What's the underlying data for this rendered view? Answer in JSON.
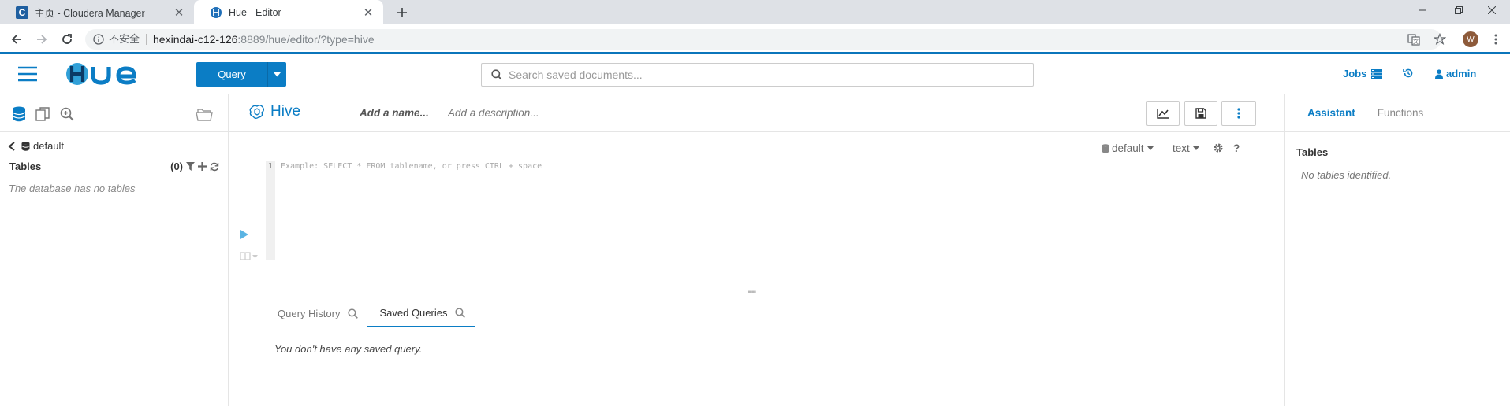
{
  "browser": {
    "tabs": [
      {
        "title": "主页 - Cloudera Manager",
        "favicon_letter": "C",
        "active": false
      },
      {
        "title": "Hue - Editor",
        "active": true
      }
    ],
    "new_tab_icon": "plus-icon",
    "security_label": "不安全",
    "url_host": "hexindai-c12-126",
    "url_path": ":8889/hue/editor/?type=hive",
    "avatar_letter": "W"
  },
  "nav": {
    "query_button": "Query",
    "search_placeholder": "Search saved documents...",
    "jobs_label": "Jobs",
    "user_label": "admin"
  },
  "left_panel": {
    "database": "default",
    "tables_label": "Tables",
    "tables_count": "(0)",
    "empty_message": "The database has no tables"
  },
  "editor": {
    "engine_title": "Hive",
    "name_placeholder": "Add a name...",
    "description_placeholder": "Add a description...",
    "database_select": "default",
    "format_select": "text",
    "help_label": "?",
    "line_number": "1",
    "code_placeholder": "Example: SELECT * FROM tablename, or press CTRL + space",
    "result_tabs": [
      {
        "label": "Query History",
        "active": false
      },
      {
        "label": "Saved Queries",
        "active": true
      }
    ],
    "saved_empty_message": "You don't have any saved query."
  },
  "right_panel": {
    "tabs": [
      {
        "label": "Assistant",
        "active": true
      },
      {
        "label": "Functions",
        "active": false
      }
    ],
    "tables_label": "Tables",
    "empty_message": "No tables identified."
  },
  "colors": {
    "accent": "#0b7dc5",
    "tabstrip": "#dee1e6"
  }
}
